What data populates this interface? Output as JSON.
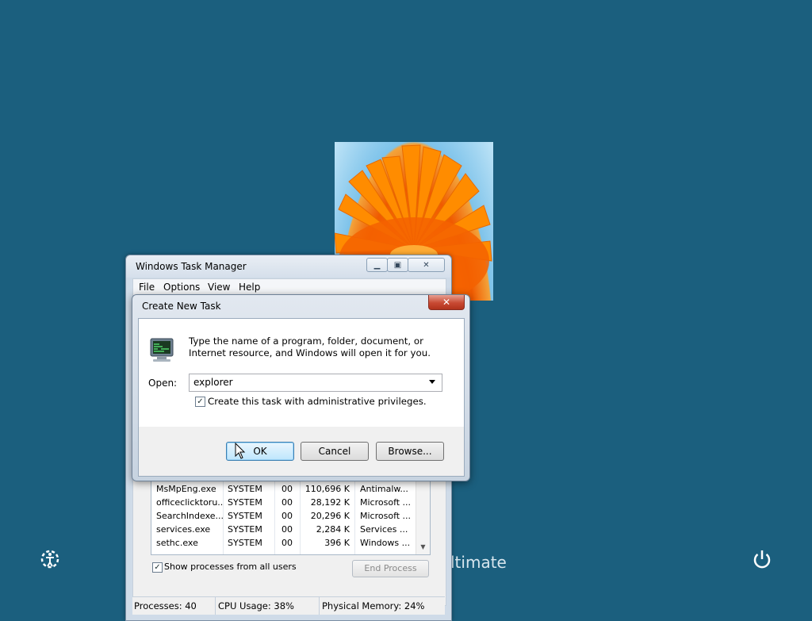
{
  "lock_screen": {
    "edition_text": "ltimate",
    "ease_of_access_icon": "ease-of-access-icon",
    "power_icon": "power-icon",
    "user_tile_image": "orange-flower-photo"
  },
  "task_manager": {
    "title": "Windows Task Manager",
    "menu": {
      "file": "File",
      "options": "Options",
      "view": "View",
      "help": "Help"
    },
    "processes": [
      {
        "name": "MsMpEng.exe",
        "user": "SYSTEM",
        "cpu": "00",
        "memory": "110,696 K",
        "description": "Antimalw..."
      },
      {
        "name": "officeclicktoru...",
        "user": "SYSTEM",
        "cpu": "00",
        "memory": "28,192 K",
        "description": "Microsoft ..."
      },
      {
        "name": "SearchIndexe...",
        "user": "SYSTEM",
        "cpu": "00",
        "memory": "20,296 K",
        "description": "Microsoft ..."
      },
      {
        "name": "services.exe",
        "user": "SYSTEM",
        "cpu": "00",
        "memory": "2,284 K",
        "description": "Services ..."
      },
      {
        "name": "sethc.exe",
        "user": "SYSTEM",
        "cpu": "00",
        "memory": "396 K",
        "description": "Windows ..."
      }
    ],
    "show_all_label": "Show processes from all users",
    "show_all_checked": true,
    "end_process_label": "End Process",
    "status": {
      "processes": "Processes: 40",
      "cpu": "CPU Usage: 38%",
      "memory": "Physical Memory: 24%"
    }
  },
  "dialog": {
    "title": "Create New Task",
    "instructions": "Type the name of a program, folder, document, or Internet resource, and Windows will open it for you.",
    "open_label": "Open:",
    "open_value": "explorer",
    "admin_label": "Create this task with administrative privileges.",
    "admin_checked": true,
    "ok_label": "OK",
    "cancel_label": "Cancel",
    "browse_label": "Browse...",
    "close_glyph": "✕"
  },
  "colors": {
    "desktop_background": "#1b5f7e",
    "ok_button_accent": "#bee6fd",
    "close_button": "#c84a33"
  }
}
